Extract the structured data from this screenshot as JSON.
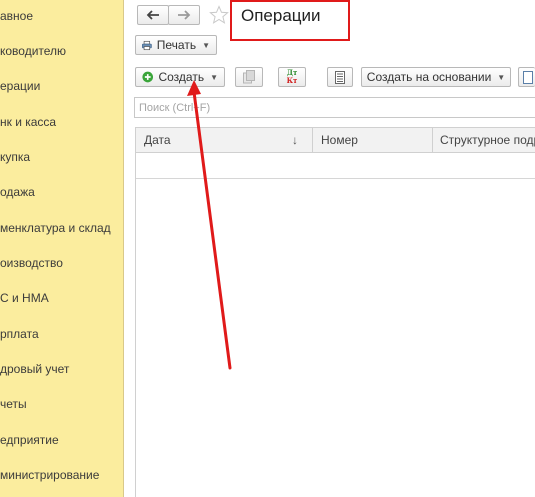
{
  "sidebar": {
    "items": [
      {
        "label": "авное"
      },
      {
        "label": "ководителю"
      },
      {
        "label": "ерации"
      },
      {
        "label": "нк и касса"
      },
      {
        "label": "купка"
      },
      {
        "label": "одажа"
      },
      {
        "label": "менклатура и склад"
      },
      {
        "label": "оизводство"
      },
      {
        "label": "С и НМА"
      },
      {
        "label": "рплата"
      },
      {
        "label": "дровый учет"
      },
      {
        "label": "четы"
      },
      {
        "label": "едприятие"
      },
      {
        "label": "министрирование"
      }
    ]
  },
  "header": {
    "title": "Операции"
  },
  "toolbar": {
    "print_label": "Печать",
    "create_label": "Создать",
    "dtkt_label_top": "Дт",
    "dtkt_label_bottom": "Кт",
    "create_based_label": "Создать на основании"
  },
  "search": {
    "placeholder": "Поиск (Ctrl+F)"
  },
  "table": {
    "columns": [
      "Дата",
      "Номер",
      "Структурное подр"
    ],
    "sort_indicator": "↓"
  },
  "colors": {
    "sidebar_bg": "#fbed9e",
    "annotation_red": "#e01a1a",
    "create_icon_green": "#3aa53a"
  },
  "icons": {
    "back": "arrow-left-icon",
    "forward": "arrow-right-icon",
    "favorite": "star-icon",
    "print": "printer-icon",
    "create": "plus-circle-icon",
    "copy": "copy-icon",
    "dtkt": "dt-kt-icon",
    "list": "list-icon"
  }
}
